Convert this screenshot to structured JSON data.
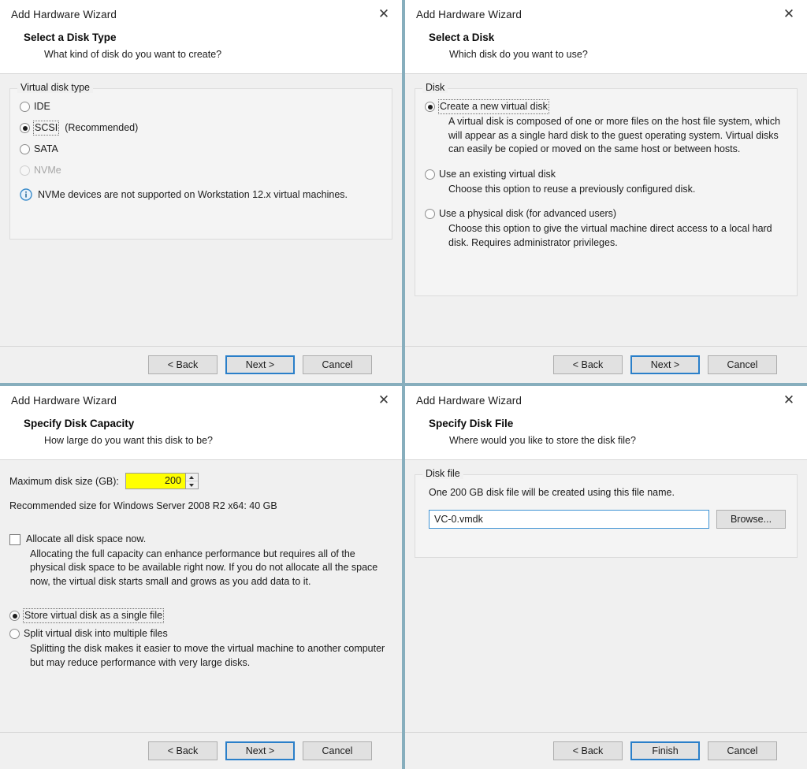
{
  "colors": {
    "accent_focus_border": "#2a7fc9",
    "divider": "#87aebd",
    "spinner_highlight": "#ffff00",
    "body_bg": "#f0f0f0",
    "info_icon": "#3b8ccb"
  },
  "panels": [
    {
      "window_title": "Add Hardware Wizard",
      "close_glyph": "✕",
      "heading": "Select a Disk Type",
      "subheading": "What kind of disk do you want to create?",
      "group_legend": "Virtual disk type",
      "options": [
        {
          "label": "IDE",
          "checked": false,
          "disabled": false,
          "focused": false,
          "suffix": ""
        },
        {
          "label": "SCSI",
          "checked": true,
          "disabled": false,
          "focused": true,
          "suffix": "(Recommended)"
        },
        {
          "label": "SATA",
          "checked": false,
          "disabled": false,
          "focused": false,
          "suffix": ""
        },
        {
          "label": "NVMe",
          "checked": false,
          "disabled": true,
          "focused": false,
          "suffix": ""
        }
      ],
      "info_text": "NVMe devices are not supported on Workstation 12.x virtual machines.",
      "info_icon_name": "info-icon",
      "buttons": [
        {
          "label": "< Back",
          "default": false
        },
        {
          "label": "Next >",
          "default": true
        },
        {
          "label": "Cancel",
          "default": false
        }
      ]
    },
    {
      "window_title": "Add Hardware Wizard",
      "close_glyph": "✕",
      "heading": "Select a Disk",
      "subheading": "Which disk do you want to use?",
      "group_legend": "Disk",
      "options": [
        {
          "label": "Create a new virtual disk",
          "checked": true,
          "focused": true,
          "description": "A virtual disk is composed of one or more files on the host file system, which will appear as a single hard disk to the guest operating system. Virtual disks can easily be copied or moved on the same host or between hosts."
        },
        {
          "label": "Use an existing virtual disk",
          "checked": false,
          "focused": false,
          "description": "Choose this option to reuse a previously configured disk."
        },
        {
          "label": "Use a physical disk (for advanced users)",
          "checked": false,
          "focused": false,
          "description": "Choose this option to give the virtual machine direct access to a local hard disk. Requires administrator privileges."
        }
      ],
      "buttons": [
        {
          "label": "< Back",
          "default": false
        },
        {
          "label": "Next >",
          "default": true
        },
        {
          "label": "Cancel",
          "default": false
        }
      ]
    },
    {
      "window_title": "Add Hardware Wizard",
      "close_glyph": "✕",
      "heading": "Specify Disk Capacity",
      "subheading": "How large do you want this disk to be?",
      "capacity_label": "Maximum disk size (GB):",
      "capacity_value": "200",
      "recommended_text": "Recommended size for Windows Server 2008 R2 x64: 40 GB",
      "allocate_checkbox": {
        "label": "Allocate all disk space now.",
        "checked": false,
        "description": "Allocating the full capacity can enhance performance but requires all of the physical disk space to be available right now. If you do not allocate all the space now, the virtual disk starts small and grows as you add data to it."
      },
      "store_options": [
        {
          "label": "Store virtual disk as a single file",
          "checked": true,
          "focused": true,
          "description": ""
        },
        {
          "label": "Split virtual disk into multiple files",
          "checked": false,
          "focused": false,
          "description": "Splitting the disk makes it easier to move the virtual machine to another computer but may reduce performance with very large disks."
        }
      ],
      "buttons": [
        {
          "label": "< Back",
          "default": false
        },
        {
          "label": "Next >",
          "default": true
        },
        {
          "label": "Cancel",
          "default": false
        }
      ]
    },
    {
      "window_title": "Add Hardware Wizard",
      "close_glyph": "✕",
      "heading": "Specify Disk File",
      "subheading": "Where would you like to store the disk file?",
      "group_legend": "Disk file",
      "note_text": "One 200 GB disk file will be created using this file name.",
      "file_value": "VC-0.vmdk",
      "file_placeholder": "",
      "browse_label": "Browse...",
      "buttons": [
        {
          "label": "< Back",
          "default": false
        },
        {
          "label": "Finish",
          "default": true
        },
        {
          "label": "Cancel",
          "default": false
        }
      ]
    }
  ]
}
